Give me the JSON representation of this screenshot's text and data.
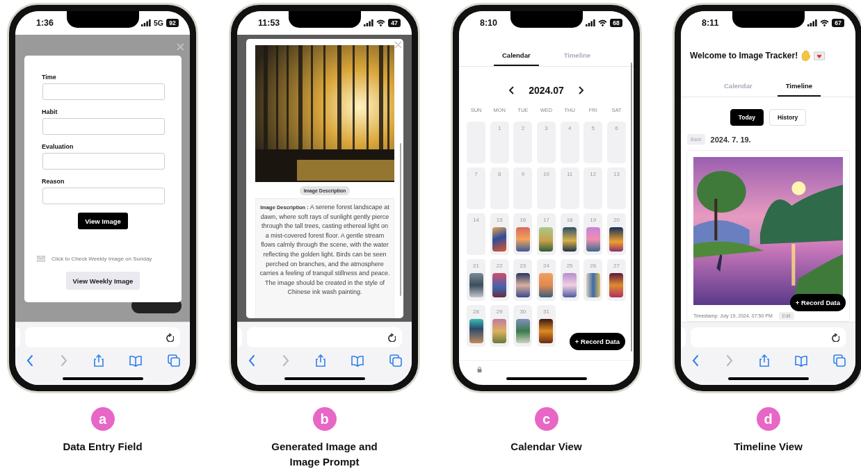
{
  "panels": [
    {
      "kind": "form",
      "letter": "a",
      "caption": "Data Entry Field",
      "status": {
        "time": "1:36",
        "network": {
          "kind": "cellular",
          "label": "5G"
        },
        "battery": "92"
      },
      "form": {
        "fields": [
          {
            "label": "Time"
          },
          {
            "label": "Habit"
          },
          {
            "label": "Evaluation"
          },
          {
            "label": "Reason"
          }
        ],
        "submit": "View Image",
        "weekly_note": "Click to Check Weekly Image on Sunday",
        "weekly_button": "View Weekly Image"
      },
      "bottom": {
        "kind": "browser"
      }
    },
    {
      "kind": "image_prompt",
      "letter": "b",
      "caption": "Generated Image and Image Prompt",
      "status": {
        "time": "11:53",
        "network": {
          "kind": "wifi"
        },
        "battery": "47"
      },
      "prompt": {
        "chip": "Image Description",
        "description": "**Image Description :** A serene forest landscape at dawn, where soft rays of sunlight gently pierce through the tall trees, casting ethereal light on a mist-covered forest floor. A gentle stream flows calmly through the scene, with the water reflecting the golden light. Birds can be seen perched on branches, and the atmosphere carries a feeling of tranquil stillness and peace. The image should be created in the style of Chinese ink wash painting."
      },
      "bottom": {
        "kind": "browser"
      }
    },
    {
      "kind": "calendar",
      "letter": "c",
      "caption": "Calendar View",
      "status": {
        "time": "8:10",
        "network": {
          "kind": "wifi"
        },
        "battery": "68"
      },
      "tabs": [
        {
          "label": "Calendar",
          "selected": true
        },
        {
          "label": "Timeline",
          "selected": false
        }
      ],
      "calendar": {
        "month": "2024.07",
        "weekdays": [
          "SUN",
          "MON",
          "TUE",
          "WED",
          "THU",
          "FRI",
          "SAT"
        ],
        "weeks": [
          [
            {
              "has_image": false
            },
            {
              "day": "1",
              "has_image": false
            },
            {
              "day": "2",
              "has_image": false
            },
            {
              "day": "3",
              "has_image": false
            },
            {
              "day": "4",
              "has_image": false
            },
            {
              "day": "5",
              "has_image": false
            },
            {
              "day": "6",
              "has_image": false
            }
          ],
          [
            {
              "day": "7",
              "has_image": false
            },
            {
              "day": "8",
              "has_image": false
            },
            {
              "day": "9",
              "has_image": false
            },
            {
              "day": "10",
              "has_image": false
            },
            {
              "day": "11",
              "has_image": false
            },
            {
              "day": "12",
              "has_image": false
            },
            {
              "day": "13",
              "has_image": false
            }
          ],
          [
            {
              "day": "14",
              "has_image": false
            },
            {
              "day": "15",
              "has_image": true
            },
            {
              "day": "16",
              "has_image": true
            },
            {
              "day": "17",
              "has_image": true
            },
            {
              "day": "18",
              "has_image": true
            },
            {
              "day": "19",
              "has_image": true
            },
            {
              "day": "20",
              "has_image": true
            }
          ],
          [
            {
              "day": "21",
              "has_image": true
            },
            {
              "day": "22",
              "has_image": true
            },
            {
              "day": "23",
              "has_image": true
            },
            {
              "day": "24",
              "has_image": true
            },
            {
              "day": "25",
              "has_image": true
            },
            {
              "day": "26",
              "has_image": true
            },
            {
              "day": "27",
              "has_image": true
            }
          ],
          [
            {
              "day": "28",
              "has_image": true
            },
            {
              "day": "29",
              "has_image": true
            },
            {
              "day": "30",
              "has_image": true
            },
            {
              "day": "31",
              "has_image": true
            }
          ]
        ]
      },
      "record_button": "+ Record Data",
      "bottom": {
        "kind": "lock"
      }
    },
    {
      "kind": "timeline",
      "letter": "d",
      "caption": "Timeline View",
      "status": {
        "time": "8:11",
        "network": {
          "kind": "wifi"
        },
        "battery": "67"
      },
      "title": "Welcome to Image Tracker!",
      "tabs": [
        {
          "label": "Calendar",
          "selected": false
        },
        {
          "label": "Timeline",
          "selected": true
        }
      ],
      "segments": [
        {
          "label": "Today",
          "selected": true
        },
        {
          "label": "History",
          "selected": false
        }
      ],
      "back": "Back",
      "date": "2024. 7. 19.",
      "entry": {
        "timestamp": "Timestamp: July 19, 2024, 07:50 PM",
        "edit": "Edit"
      },
      "record_button": "+ Record Data",
      "bottom": {
        "kind": "browser"
      }
    }
  ]
}
